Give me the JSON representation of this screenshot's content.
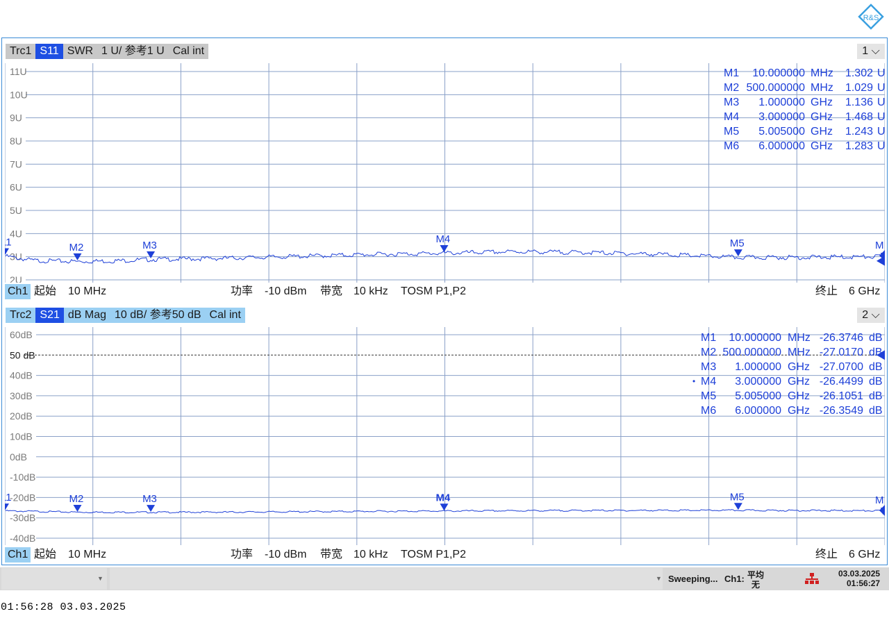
{
  "logo_text": "R&S",
  "traces": [
    {
      "items": [
        "Trc1",
        "S11",
        "SWR",
        "1 U/ 参考1 U",
        "Cal int"
      ],
      "window": "1",
      "ref_label": "1 U",
      "channel": {
        "ch": "Ch1",
        "start_label": "起始",
        "start": "10 MHz",
        "power_label": "功率",
        "power": "-10 dBm",
        "bw_label": "带宽",
        "bw": "10 kHz",
        "cal": "TOSM P1,P2",
        "stop_label": "终止",
        "stop": "6 GHz"
      },
      "markers": [
        {
          "name": "M1",
          "stim": "10.000000",
          "unit": "MHz",
          "value": "1.302",
          "vunit": "U"
        },
        {
          "name": "M2",
          "stim": "500.000000",
          "unit": "MHz",
          "value": "1.029",
          "vunit": "U"
        },
        {
          "name": "M3",
          "stim": "1.000000",
          "unit": "GHz",
          "value": "1.136",
          "vunit": "U"
        },
        {
          "name": "M4",
          "stim": "3.000000",
          "unit": "GHz",
          "value": "1.468",
          "vunit": "U"
        },
        {
          "name": "M5",
          "stim": "5.005000",
          "unit": "GHz",
          "value": "1.243",
          "vunit": "U"
        },
        {
          "name": "M6",
          "stim": "6.000000",
          "unit": "GHz",
          "value": "1.283",
          "vunit": "U"
        }
      ]
    },
    {
      "items": [
        "Trc2",
        "S21",
        "dB Mag",
        "10 dB/ 参考50 dB",
        "Cal int"
      ],
      "window": "2",
      "ref_label": "50 dB",
      "channel": {
        "ch": "Ch1",
        "start_label": "起始",
        "start": "10 MHz",
        "power_label": "功率",
        "power": "-10 dBm",
        "bw_label": "带宽",
        "bw": "10 kHz",
        "cal": "TOSM P1,P2",
        "stop_label": "终止",
        "stop": "6 GHz"
      },
      "markers": [
        {
          "name": "M1",
          "stim": "10.000000",
          "unit": "MHz",
          "value": "-26.3746",
          "vunit": "dB"
        },
        {
          "name": "M2",
          "stim": "500.000000",
          "unit": "MHz",
          "value": "-27.0170",
          "vunit": "dB"
        },
        {
          "name": "M3",
          "stim": "1.000000",
          "unit": "GHz",
          "value": "-27.0700",
          "vunit": "dB"
        },
        {
          "name": "M4",
          "stim": "3.000000",
          "unit": "GHz",
          "value": "-26.4499",
          "vunit": "dB"
        },
        {
          "name": "M5",
          "stim": "5.005000",
          "unit": "GHz",
          "value": "-26.1051",
          "vunit": "dB"
        },
        {
          "name": "M6",
          "stim": "6.000000",
          "unit": "GHz",
          "value": "-26.3549",
          "vunit": "dB"
        }
      ]
    }
  ],
  "status": {
    "sweep": "Sweeping...",
    "ch": "Ch1:",
    "avg_label": "平均",
    "avg_value": "无",
    "date": "03.03.2025",
    "time": "01:56:27"
  },
  "bottom_timestamp": "01:56:28   03.03.2025",
  "colors": {
    "trace": "#1e40d8",
    "grid": "#8aa0c8",
    "frame": "#3a8ad6",
    "selected": "#1e4fe3"
  },
  "chart_data": [
    {
      "type": "line",
      "title": "Trc1 S11 SWR",
      "xlabel": "",
      "ylabel": "",
      "xlim": [
        0.01,
        6.0
      ],
      "x_unit": "GHz",
      "ylim": [
        0,
        11
      ],
      "y_ticks": [
        "11U",
        "10U",
        "9U",
        "8U",
        "7U",
        "6U",
        "5U",
        "4U",
        "3U",
        "2U"
      ],
      "reference": 1,
      "grid": true,
      "series": [
        {
          "x": [
            0.01,
            0.2,
            0.5,
            0.75,
            1.0,
            1.5,
            2.0,
            2.5,
            3.0,
            3.5,
            4.0,
            4.5,
            5.005,
            5.5,
            6.0
          ],
          "y": [
            1.302,
            1.08,
            1.029,
            1.06,
            1.136,
            1.2,
            1.3,
            1.4,
            1.468,
            1.55,
            1.5,
            1.4,
            1.243,
            1.25,
            1.283
          ]
        }
      ],
      "markers": [
        {
          "name": "M1",
          "x": 0.01,
          "y": 1.302
        },
        {
          "name": "M2",
          "x": 0.5,
          "y": 1.029
        },
        {
          "name": "M3",
          "x": 1.0,
          "y": 1.136
        },
        {
          "name": "M4",
          "x": 3.0,
          "y": 1.468
        },
        {
          "name": "M5",
          "x": 5.005,
          "y": 1.243
        },
        {
          "name": "M6",
          "x": 6.0,
          "y": 1.283
        }
      ]
    },
    {
      "type": "line",
      "title": "Trc2 S21 dB Mag",
      "xlabel": "",
      "ylabel": "",
      "xlim": [
        0.01,
        6.0
      ],
      "x_unit": "GHz",
      "ylim": [
        -40,
        60
      ],
      "y_ticks": [
        "60dB",
        "50 dB",
        "40dB",
        "30dB",
        "20dB",
        "10dB",
        "0dB",
        "-10dB",
        "-20dB",
        "-30dB",
        "-40dB"
      ],
      "reference": 50,
      "grid": true,
      "series": [
        {
          "x": [
            0.01,
            0.5,
            1.0,
            1.5,
            2.0,
            2.5,
            3.0,
            3.5,
            4.0,
            4.5,
            5.005,
            5.5,
            6.0
          ],
          "y": [
            -26.3746,
            -27.017,
            -27.07,
            -27.0,
            -26.8,
            -26.6,
            -26.4499,
            -26.3,
            -26.2,
            -26.15,
            -26.1051,
            -26.2,
            -26.3549
          ]
        }
      ],
      "markers": [
        {
          "name": "M1",
          "x": 0.01,
          "y": -26.3746
        },
        {
          "name": "M2",
          "x": 0.5,
          "y": -27.017
        },
        {
          "name": "M3",
          "x": 1.0,
          "y": -27.07
        },
        {
          "name": "M4",
          "x": 3.0,
          "y": -26.4499
        },
        {
          "name": "M5",
          "x": 5.005,
          "y": -26.1051
        },
        {
          "name": "M6",
          "x": 6.0,
          "y": -26.3549
        }
      ]
    }
  ]
}
